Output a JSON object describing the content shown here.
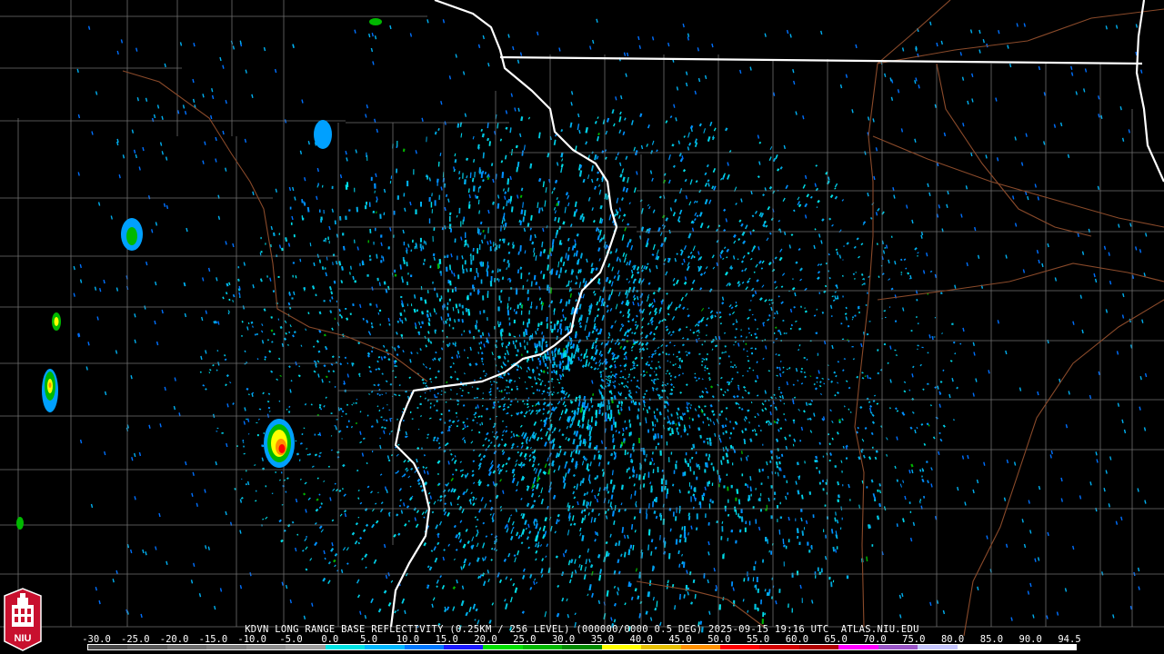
{
  "product": {
    "station": "KDVN",
    "line": "KDVN LONG RANGE BASE REFLECTIVITY (0.25KM / 256 LEVEL) (000000/0000 0.5 DEG) 2025-09-15 19:16 UTC  ATLAS.NIU.EDU"
  },
  "scale": {
    "labels": [
      "-30.0",
      "-25.0",
      "-20.0",
      "-15.0",
      "-10.0",
      "-5.0",
      "0.0",
      "5.0",
      "10.0",
      "15.0",
      "20.0",
      "25.0",
      "30.0",
      "35.0",
      "40.0",
      "45.0",
      "50.0",
      "55.0",
      "60.0",
      "65.0",
      "70.0",
      "75.0",
      "80.0",
      "85.0",
      "90.0",
      "94.5"
    ],
    "colors": [
      "#4a4a4a",
      "#5a5a5a",
      "#6e6e6e",
      "#7e7e7e",
      "#8e8e8e",
      "#9e9e9e",
      "#00e4e4",
      "#00b8ff",
      "#0078ff",
      "#1a1aff",
      "#00e000",
      "#00b800",
      "#008a00",
      "#ffff00",
      "#e6c000",
      "#ff9000",
      "#ff0000",
      "#d40000",
      "#b00000",
      "#ff00ff",
      "#9a55c8",
      "#c8c8ff",
      "#ffffff",
      "#ffffff",
      "#ffffff"
    ]
  },
  "logo": {
    "text": "NIU",
    "icon": "niu-tower-icon"
  },
  "colors": {
    "background": "#000000",
    "county_lines": "#6f6f6f",
    "state_lines": "#ffffff",
    "roads": "#8a4a2a",
    "echo_light": "#00d0e8",
    "echo_mid": "#00a0ff",
    "echo_heavy": "#00c000",
    "echo_core": "#ff0000"
  },
  "storm_cells": [
    {
      "name": "cell-west-north",
      "intensity": "moderate"
    },
    {
      "name": "cell-west-mid",
      "intensity": "moderate"
    },
    {
      "name": "cell-west-south",
      "intensity": "strong"
    },
    {
      "name": "cell-southwest",
      "intensity": "intense"
    }
  ]
}
